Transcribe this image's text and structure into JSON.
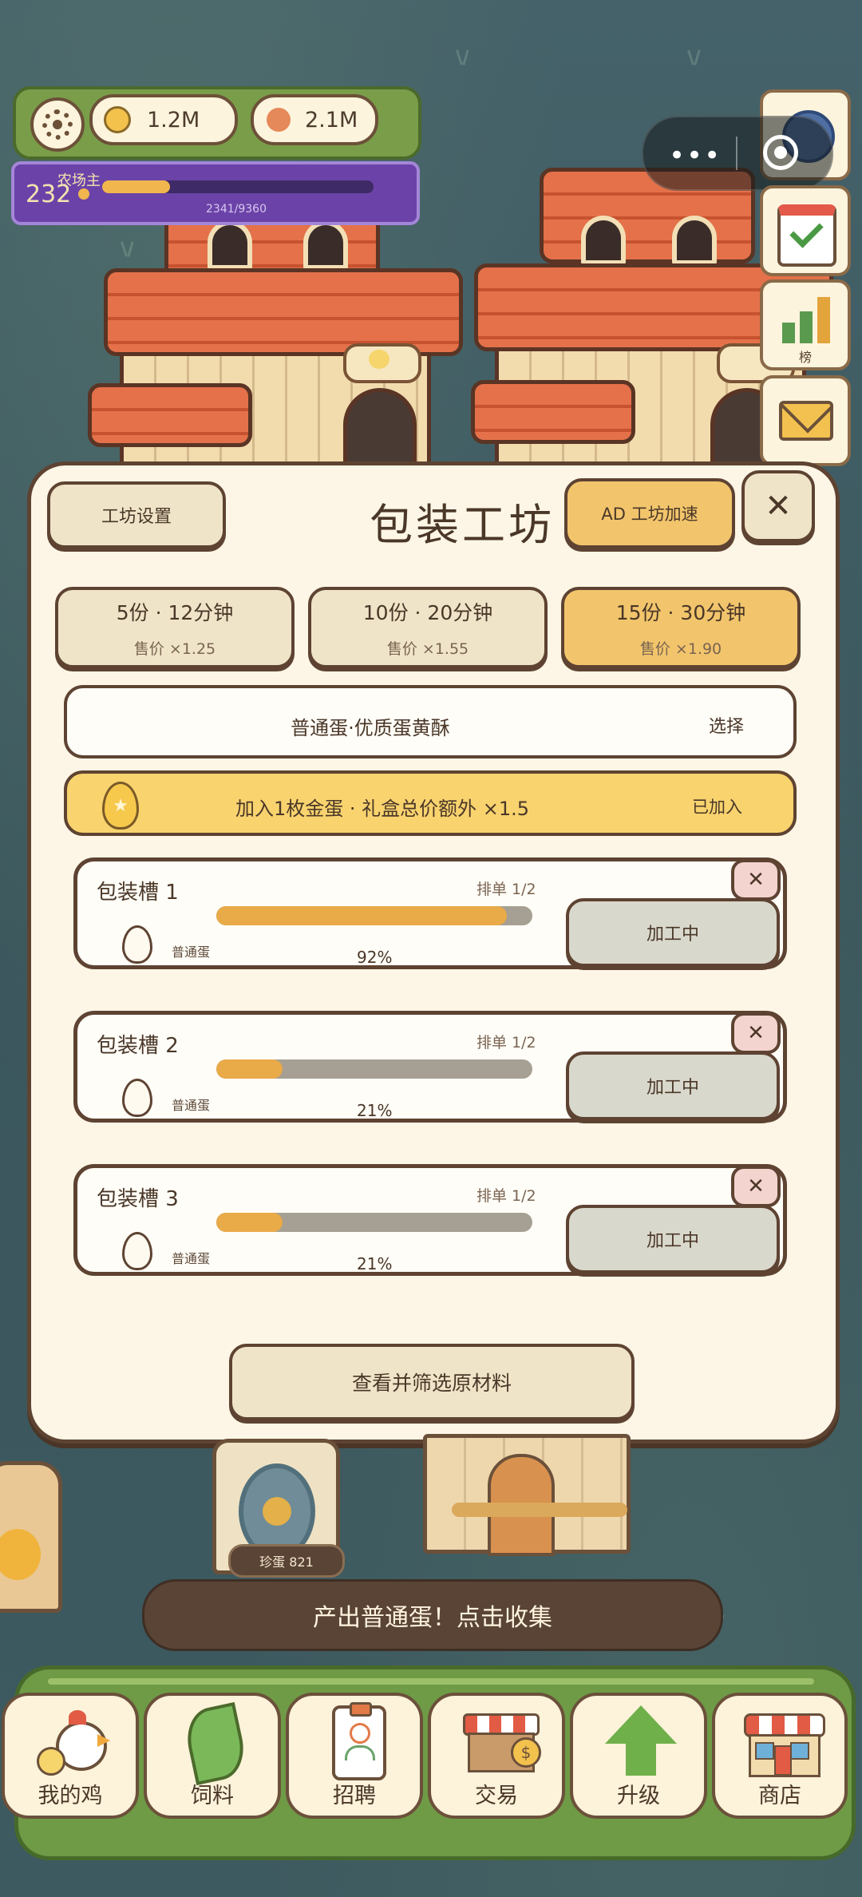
{
  "hud": {
    "coins": "1.2M",
    "gems": "2.1M",
    "level": "232",
    "title": "农场主",
    "xp_text": "2341/9360",
    "xp_progress": 0.25
  },
  "side": {
    "rank_label": "榜"
  },
  "panel": {
    "settings_label": "工坊设置",
    "title": "包装工坊",
    "ad_label": "AD 工坊加速",
    "close_label": "✕",
    "options": [
      {
        "main": "5份 · 12分钟",
        "sub": "售价 ×1.25",
        "selected": false
      },
      {
        "main": "10份 · 20分钟",
        "sub": "售价 ×1.55",
        "selected": false
      },
      {
        "main": "15份 · 30分钟",
        "sub": "售价 ×1.90",
        "selected": true
      }
    ],
    "material": {
      "label": "普通蛋·优质蛋黄酥",
      "action": "选择"
    },
    "gold_egg": {
      "label": "加入1枚金蛋 · 礼盒总价额外 ×1.5",
      "action": "已加入"
    },
    "slots": [
      {
        "name": "包装槽 1",
        "queue": "排单 1/2",
        "egg": "普通蛋",
        "percent": "92%",
        "progress": 0.92,
        "status": "加工中",
        "close": "✕"
      },
      {
        "name": "包装槽 2",
        "queue": "排单 1/2",
        "egg": "普通蛋",
        "percent": "21%",
        "progress": 0.21,
        "status": "加工中",
        "close": "✕"
      },
      {
        "name": "包装槽 3",
        "queue": "排单 1/2",
        "egg": "普通蛋",
        "percent": "21%",
        "progress": 0.21,
        "status": "加工中",
        "close": "✕"
      }
    ],
    "filter_label": "查看并筛选原材料"
  },
  "scene": {
    "machine_tag": "珍蛋 821",
    "toast": "产出普通蛋！点击收集"
  },
  "nav": [
    {
      "label": "我的鸡",
      "icon": "chicken-icon"
    },
    {
      "label": "饲料",
      "icon": "leaf-icon"
    },
    {
      "label": "招聘",
      "icon": "recruit-badge-icon"
    },
    {
      "label": "交易",
      "icon": "market-stall-icon"
    },
    {
      "label": "升级",
      "icon": "up-arrow-icon"
    },
    {
      "label": "商店",
      "icon": "shop-icon"
    }
  ]
}
